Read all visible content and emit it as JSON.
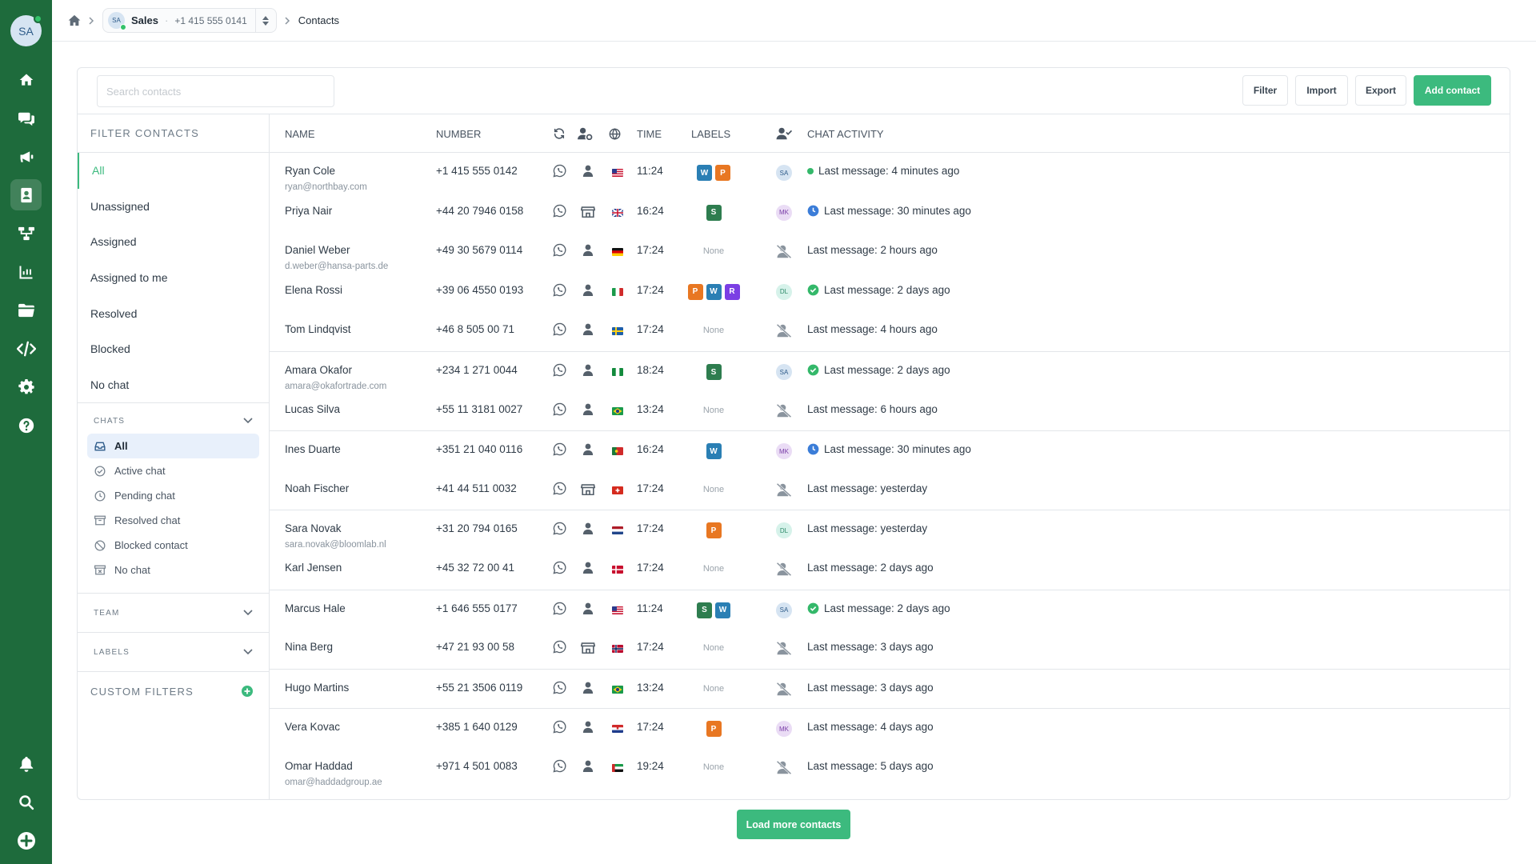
{
  "app": {
    "user_initials": "SA",
    "colors": {
      "rail": "#1e6b3c",
      "accent": "#3cba7e",
      "online": "#34c26a"
    }
  },
  "rail": {
    "top_icons": [
      "home-icon",
      "chat-bubbles-icon",
      "megaphone-icon",
      "contacts-icon",
      "flow-icon",
      "analytics-icon",
      "folder-icon",
      "code-icon",
      "settings-icon",
      "help-icon"
    ],
    "bottom_icons": [
      "bell-icon",
      "search-icon",
      "add-circle-icon"
    ]
  },
  "breadcrumb": {
    "workspace_initials": "SA",
    "workspace_name": "Sales",
    "workspace_separator": "·",
    "workspace_phone": "+1 415 555 0141",
    "page": "Contacts"
  },
  "toolbar": {
    "search_placeholder": "Search contacts",
    "filter": "Filter",
    "import": "Import",
    "export": "Export",
    "add_contact": "Add contact"
  },
  "filters": {
    "title": "FILTER CONTACTS",
    "items": [
      "All",
      "Unassigned",
      "Assigned",
      "Assigned to me",
      "Resolved",
      "Blocked",
      "No chat"
    ],
    "active": "All",
    "chats": {
      "title": "CHATS",
      "items": [
        {
          "label": "All",
          "icon": "inbox-icon"
        },
        {
          "label": "Active chat",
          "icon": "check-circle-icon"
        },
        {
          "label": "Pending chat",
          "icon": "clock-icon"
        },
        {
          "label": "Resolved chat",
          "icon": "archive-icon"
        },
        {
          "label": "Blocked contact",
          "icon": "blocked-icon"
        },
        {
          "label": "No chat",
          "icon": "no-chat-icon"
        }
      ]
    },
    "team": "TEAM",
    "labels": "LABELS",
    "custom_filters": "CUSTOM FILTERS"
  },
  "table": {
    "headers": {
      "name": "NAME",
      "number": "NUMBER",
      "time": "TIME",
      "labels": "LABELS",
      "activity": "CHAT ACTIVITY"
    },
    "header_icons": [
      "sync-icon",
      "user-settings-icon",
      "globe-icon",
      "assignee-icon"
    ],
    "label_colors": {
      "W": "#2a7fb4",
      "P": "#e87722",
      "S": "#2e7d4f",
      "R": "#7b3fe4"
    },
    "rows": [
      {
        "name": "Ryan Cole",
        "email": "ryan@northbay.com",
        "number": "+1 415 555 0142",
        "type": "person",
        "flag": "us",
        "time": "11:24",
        "labels": [
          "W",
          "P"
        ],
        "assignee": "SA",
        "status": "dot",
        "activity": "Last message: 4 minutes ago"
      },
      {
        "name": "Priya Nair",
        "email": "",
        "number": "+44 20 7946 0158",
        "type": "business",
        "flag": "gb",
        "time": "16:24",
        "labels": [
          "S"
        ],
        "assignee": "MK",
        "status": "clock",
        "activity": "Last message: 30 minutes ago"
      },
      {
        "name": "Daniel Weber",
        "email": "d.weber@hansa-parts.de",
        "number": "+49 30 5679 0114",
        "type": "person",
        "flag": "de",
        "time": "17:24",
        "labels": [],
        "assignee": "",
        "status": "",
        "activity": "Last message: 2 hours ago"
      },
      {
        "name": "Elena Rossi",
        "email": "",
        "number": "+39 06 4550 0193",
        "type": "person",
        "flag": "it",
        "time": "17:24",
        "labels": [
          "P",
          "W",
          "R"
        ],
        "assignee": "DL",
        "status": "check",
        "activity": "Last message: 2 days ago"
      },
      {
        "name": "Tom Lindqvist",
        "email": "",
        "number": "+46 8 505 00 71",
        "type": "person",
        "flag": "se",
        "time": "17:24",
        "labels": [],
        "assignee": "",
        "status": "",
        "activity": "Last message: 4 hours ago"
      },
      {
        "name": "Amara Okafor",
        "email": "amara@okafortrade.com",
        "number": "+234 1 271 0044",
        "type": "person",
        "flag": "ng",
        "time": "18:24",
        "labels": [
          "S"
        ],
        "assignee": "SA",
        "status": "check",
        "activity": "Last message: 2 days ago"
      },
      {
        "name": "Lucas Silva",
        "email": "",
        "number": "+55 11 3181 0027",
        "type": "person",
        "flag": "br",
        "time": "13:24",
        "labels": [],
        "assignee": "",
        "status": "",
        "activity": "Last message: 6 hours ago"
      },
      {
        "name": "Ines Duarte",
        "email": "",
        "number": "+351 21 040 0116",
        "type": "person",
        "flag": "pt",
        "time": "16:24",
        "labels": [
          "W"
        ],
        "assignee": "MK",
        "status": "clock",
        "activity": "Last message: 30 minutes ago"
      },
      {
        "name": "Noah Fischer",
        "email": "",
        "number": "+41 44 511 0032",
        "type": "business",
        "flag": "ch",
        "time": "17:24",
        "labels": [],
        "assignee": "",
        "status": "",
        "activity": "Last message: yesterday"
      },
      {
        "name": "Sara Novak",
        "email": "sara.novak@bloomlab.nl",
        "number": "+31 20 794 0165",
        "type": "person",
        "flag": "nl",
        "time": "17:24",
        "labels": [
          "P"
        ],
        "assignee": "DL",
        "status": "",
        "activity": "Last message: yesterday"
      },
      {
        "name": "Karl Jensen",
        "email": "",
        "number": "+45 32 72 00 41",
        "type": "person",
        "flag": "dk",
        "time": "17:24",
        "labels": [],
        "assignee": "",
        "status": "",
        "activity": "Last message: 2 days ago"
      },
      {
        "name": "Marcus Hale",
        "email": "",
        "number": "+1 646 555 0177",
        "type": "person",
        "flag": "us",
        "time": "11:24",
        "labels": [
          "S",
          "W"
        ],
        "assignee": "SA",
        "status": "check",
        "activity": "Last message: 2 days ago"
      },
      {
        "name": "Nina Berg",
        "email": "",
        "number": "+47 21 93 00 58",
        "type": "business",
        "flag": "no",
        "time": "17:24",
        "labels": [],
        "assignee": "",
        "status": "",
        "activity": "Last message: 3 days ago"
      },
      {
        "name": "Hugo Martins",
        "email": "",
        "number": "+55 21 3506 0119",
        "type": "person",
        "flag": "br",
        "time": "13:24",
        "labels": [],
        "assignee": "",
        "status": "",
        "activity": "Last message: 3 days ago"
      },
      {
        "name": "Vera Kovac",
        "email": "",
        "number": "+385 1 640 0129",
        "type": "person",
        "flag": "hr",
        "time": "17:24",
        "labels": [
          "P"
        ],
        "assignee": "MK",
        "status": "",
        "activity": "Last message: 4 days ago"
      },
      {
        "name": "Omar Haddad",
        "email": "omar@haddadgroup.ae",
        "number": "+971 4 501 0083",
        "type": "person",
        "flag": "ae",
        "time": "19:24",
        "labels": [],
        "assignee": "",
        "status": "",
        "activity": "Last message: 5 days ago"
      }
    ],
    "none_text": "None",
    "separators_before": [
      5,
      7,
      9,
      11,
      13,
      14
    ]
  },
  "load_more": "Load more contacts"
}
